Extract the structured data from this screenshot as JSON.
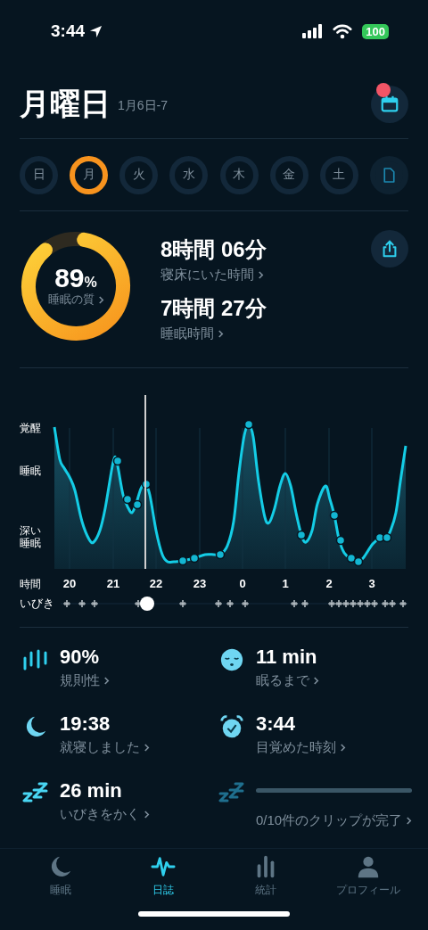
{
  "status_bar": {
    "time": "3:44",
    "battery": "100"
  },
  "header": {
    "title": "月曜日",
    "subtitle": "1月6日-7",
    "notification": true
  },
  "days": [
    {
      "label": "日",
      "selected": false
    },
    {
      "label": "月",
      "selected": true
    },
    {
      "label": "火",
      "selected": false
    },
    {
      "label": "水",
      "selected": false
    },
    {
      "label": "木",
      "selected": false
    },
    {
      "label": "金",
      "selected": false
    },
    {
      "label": "土",
      "selected": false
    }
  ],
  "summary": {
    "quality": {
      "value": "89",
      "unit": "%",
      "label": "睡眠の質"
    },
    "durations": [
      {
        "value": "8時間 06分",
        "label": "寝床にいた時間"
      },
      {
        "value": "7時間 27分",
        "label": "睡眠時間"
      }
    ]
  },
  "sleep_chart": {
    "y_labels": [
      "覚醒",
      "睡眠",
      "深い睡眠"
    ],
    "x_title": "時間",
    "hours": [
      "20",
      "21",
      "22",
      "23",
      "0",
      "1",
      "2",
      "3"
    ],
    "snore_title": "いびき"
  },
  "stats": [
    {
      "kind": "regularity",
      "value": "90%",
      "label": "規則性"
    },
    {
      "kind": "latency",
      "value": "11 min",
      "label": "眠るまで"
    },
    {
      "kind": "bedtime",
      "value": "19:38",
      "label": "就寝しました"
    },
    {
      "kind": "wake",
      "value": "3:44",
      "label": "目覚めた時刻"
    },
    {
      "kind": "snore",
      "value": "26 min",
      "label": "いびきをかく"
    },
    {
      "kind": "clips",
      "label": "0/10件のクリップが完了"
    }
  ],
  "tabs": [
    {
      "kind": "sleep",
      "label": "睡眠",
      "selected": false
    },
    {
      "kind": "journal",
      "label": "日誌",
      "selected": true
    },
    {
      "kind": "stats",
      "label": "統計",
      "selected": false
    },
    {
      "kind": "profile",
      "label": "プロフィール",
      "selected": false
    }
  ]
}
